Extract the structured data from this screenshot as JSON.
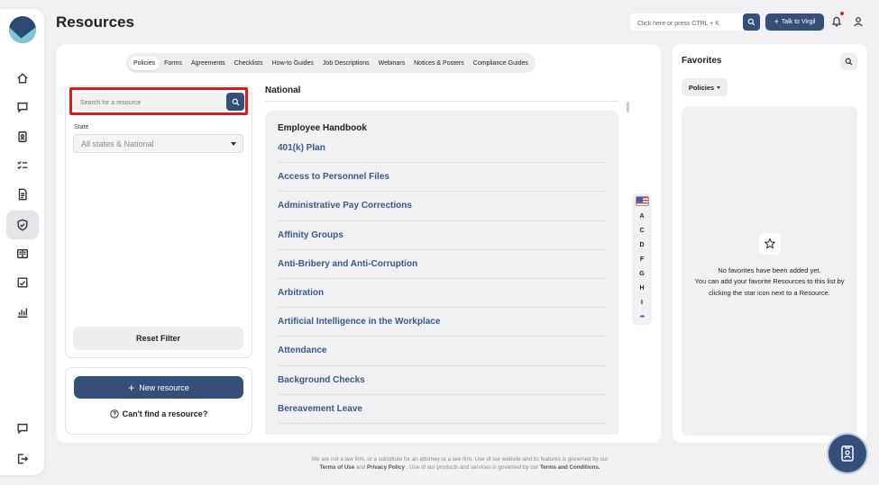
{
  "header": {
    "title": "Resources",
    "search_placeholder": "Click here or press CTRL + K",
    "talk_button": "Talk to Virgil"
  },
  "tabs": [
    "Policies",
    "Forms",
    "Agreements",
    "Checklists",
    "How-to Guides",
    "Job Descriptions",
    "Webinars",
    "Notices & Posters",
    "Compliance Guides"
  ],
  "filter": {
    "search_placeholder": "Search for a resource",
    "state_label": "State",
    "state_value": "All states & National",
    "reset_label": "Reset Filter",
    "new_resource_label": "New resource",
    "cant_find_label": "Can't find a resource?"
  },
  "list": {
    "section_title": "National",
    "group_title": "Employee Handbook",
    "items": [
      "401(k) Plan",
      "Access to Personnel Files",
      "Administrative Pay Corrections",
      "Affinity Groups",
      "Anti-Bribery and Anti-Corruption",
      "Arbitration",
      "Artificial Intelligence in the Workplace",
      "Attendance",
      "Background Checks",
      "Bereavement Leave"
    ]
  },
  "alpha_nav": {
    "letters": [
      "A",
      "C",
      "D",
      "F",
      "G",
      "H",
      "I"
    ],
    "more": "•••"
  },
  "favorites": {
    "title": "Favorites",
    "dropdown": "Policies",
    "empty_line1": "No favorites have been added yet.",
    "empty_line2": "You can add your favorite Resources to this list by clicking the star icon next to a Resource."
  },
  "footer": {
    "text1": "We are not a law firm, or a substitute for an attorney or a law firm. Use of our website and its features is governed by our",
    "terms_of_use": "Terms of Use",
    "and": "and",
    "privacy_policy": "Privacy Policy",
    "text2": ". Use of our products and services is governed by our",
    "terms_conditions": "Terms and Conditions."
  },
  "colors": {
    "accent": "#34507a",
    "link": "#3a5a8c",
    "highlight": "#e01818"
  }
}
